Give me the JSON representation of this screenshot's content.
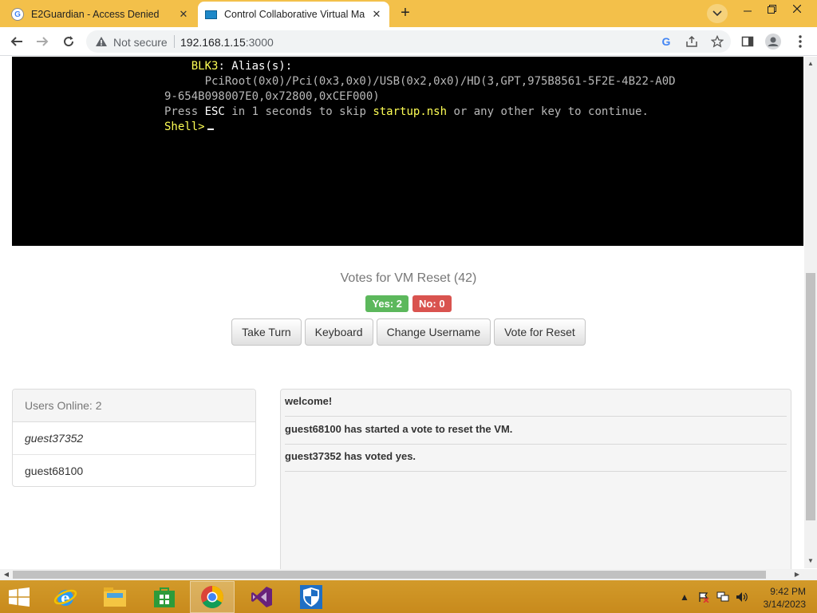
{
  "browser": {
    "tabs": [
      {
        "title": "E2Guardian - Access Denied",
        "icon": "google-g-icon",
        "active": false
      },
      {
        "title": "Control Collaborative Virtual Ma",
        "icon": "monitor-icon",
        "active": true
      }
    ],
    "security_label": "Not secure",
    "url_host": "192.168.1.15",
    "url_port": ":3000"
  },
  "terminal": {
    "lines": [
      {
        "indent": "    ",
        "label": "BLK3",
        "rest": ": Alias(s):"
      },
      {
        "text": "      PciRoot(0x0)/Pci(0x3,0x0)/USB(0x2,0x0)/HD(3,GPT,975B8561-5F2E-4B22-A0D"
      },
      {
        "text": "9-654B098007E0,0x72800,0xCEF000)"
      },
      {
        "pre": "Press ",
        "key": "ESC",
        "mid": " in 1 seconds to skip ",
        "file": "startup.nsh",
        "post": " or any other key to continue."
      },
      {
        "prompt": "Shell>"
      }
    ]
  },
  "vote": {
    "title": "Votes for VM Reset (42)",
    "yes": "Yes: 2",
    "no": "No: 0"
  },
  "controls": {
    "take_turn": "Take Turn",
    "keyboard": "Keyboard",
    "change_username": "Change Username",
    "vote_reset": "Vote for Reset"
  },
  "users": {
    "header": "Users Online: 2",
    "list": [
      "guest37352",
      "guest68100"
    ]
  },
  "chat": {
    "messages": [
      "welcome!",
      "guest68100 has started a vote to reset the VM.",
      "guest37352 has voted yes."
    ]
  },
  "taskbar": {
    "apps": [
      "start-icon",
      "internet-explorer-icon",
      "file-explorer-icon",
      "store-icon",
      "chrome-icon",
      "visual-studio-icon",
      "defender-icon"
    ],
    "time": "9:42 PM",
    "date": "3/14/2023"
  },
  "colors": {
    "tabstrip": "#f3c04a",
    "yes_badge": "#5cb85c",
    "no_badge": "#d9534f",
    "terminal_highlight": "#ffff55"
  }
}
